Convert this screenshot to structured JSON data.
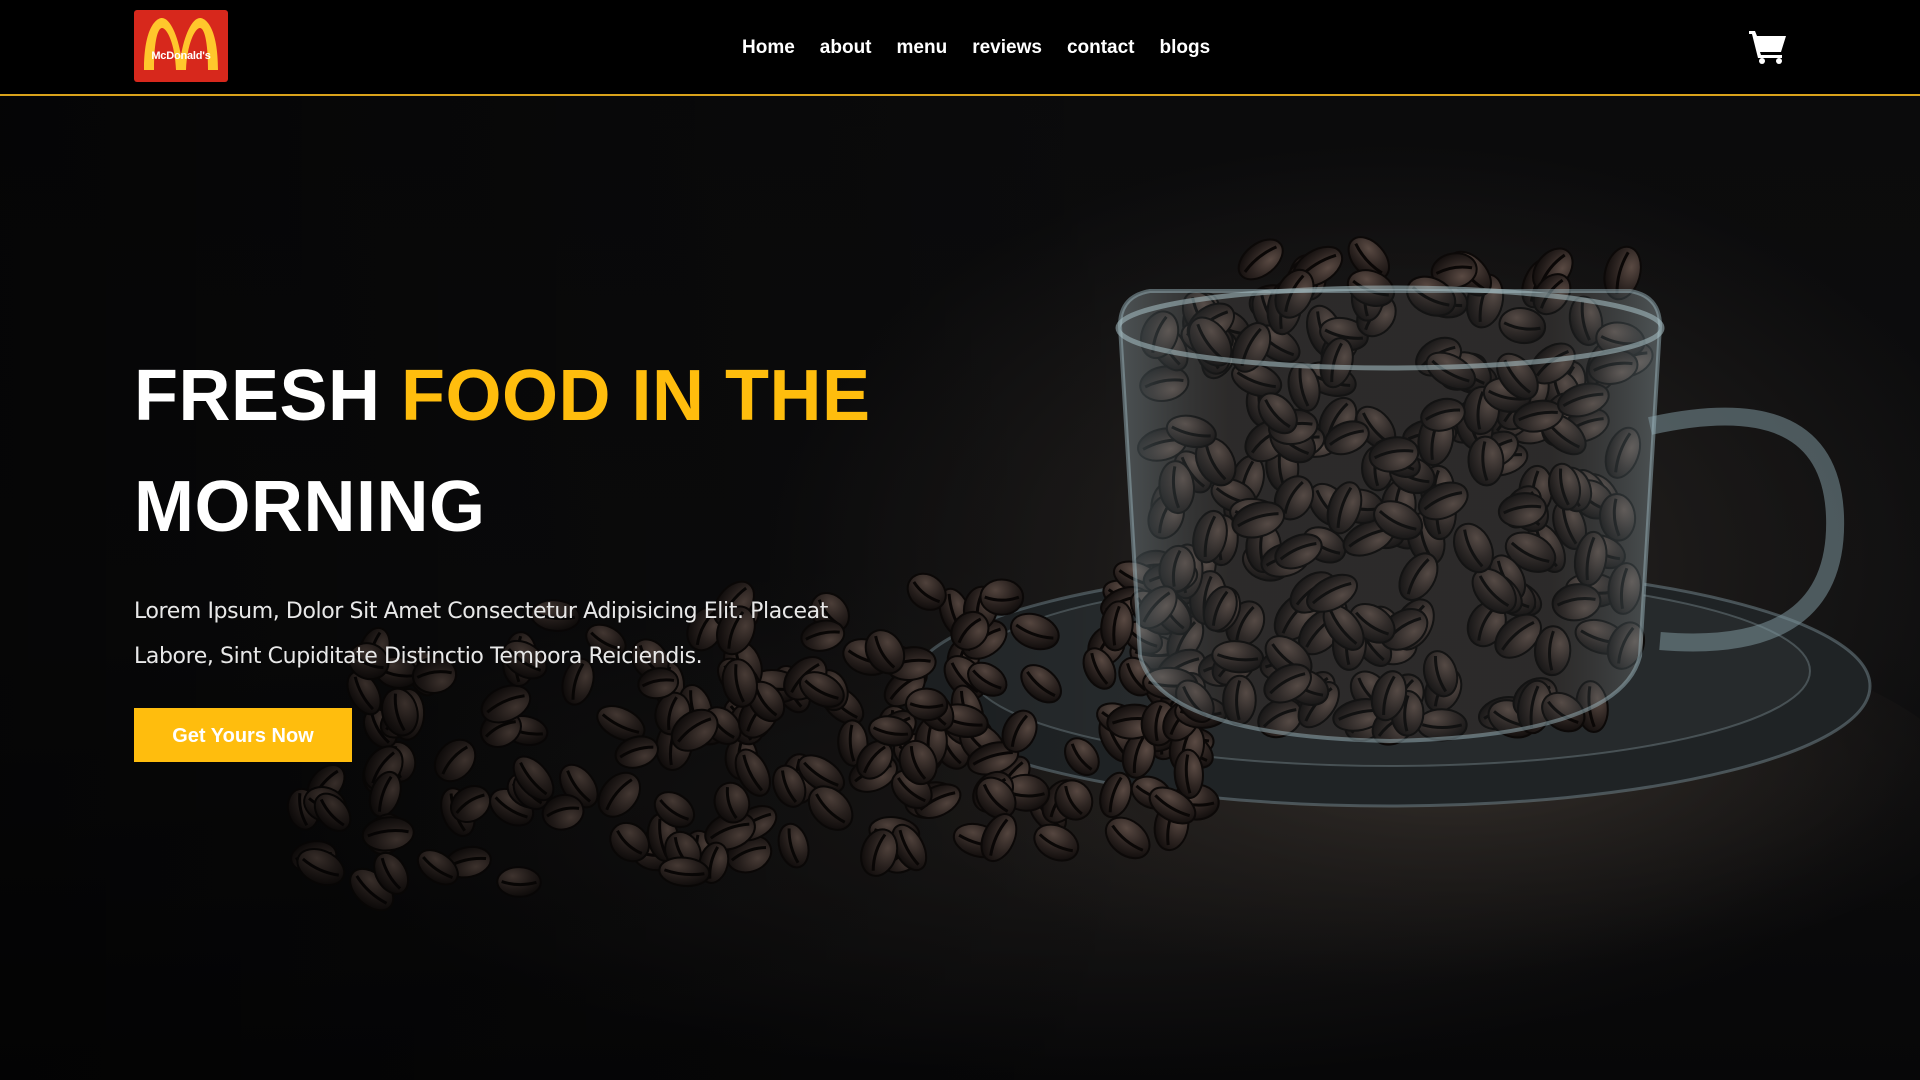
{
  "header": {
    "logo_text": "McDonald's",
    "nav": [
      "Home",
      "about",
      "menu",
      "reviews",
      "contact",
      "blogs"
    ],
    "cart_icon": "shopping-cart-icon"
  },
  "hero": {
    "title_part1": "FRESH ",
    "title_accent": "FOOD IN THE",
    "title_part2": "MORNING",
    "description": "Lorem Ipsum, Dolor Sit Amet Consectetur Adipisicing Elit. Placeat Labore, Sint Cupiditate Distinctio Tempora Reiciendis.",
    "cta_label": "Get Yours Now"
  },
  "colors": {
    "accent": "#ffbd0d",
    "header_bg": "#000000",
    "header_border": "#d9a21b",
    "logo_bg": "#d7281c",
    "logo_arches": "#ffc72c",
    "text": "#ffffff"
  }
}
